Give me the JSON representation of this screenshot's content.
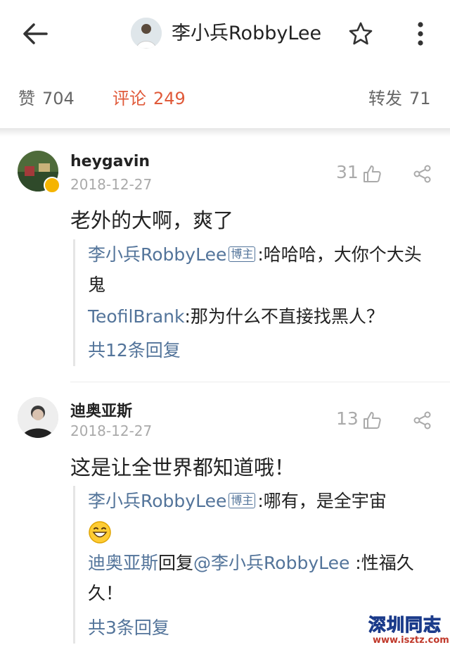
{
  "header": {
    "title": "李小兵RobbyLee"
  },
  "stats": {
    "likes_label": "赞",
    "likes_count": "704",
    "comments_label": "评论",
    "comments_count": "249",
    "reposts_label": "转发",
    "reposts_count": "71"
  },
  "comments": [
    {
      "username": "heygavin",
      "date": "2018-12-27",
      "likes": "31",
      "text": "老外的大啊，爽了",
      "replies": [
        {
          "user": "李小兵RobbyLee",
          "badge": "博主",
          "text": ":哈哈哈，大你个大头鬼"
        },
        {
          "user": "TeofilBrank",
          "text": ":那为什么不直接找黑人？"
        }
      ],
      "more_replies": "共12条回复"
    },
    {
      "username": "迪奥亚斯",
      "date": "2018-12-27",
      "likes": "13",
      "text": "这是让全世界都知道哦！",
      "replies": [
        {
          "user": "李小兵RobbyLee",
          "badge": "博主",
          "text": ":哪有，是全宇宙"
        },
        {
          "user": "迪奥亚斯",
          "mid": "回复",
          "mention": "@李小兵RobbyLee",
          "text": " :性福久久！"
        }
      ],
      "more_replies": "共3条回复"
    }
  ],
  "watermark": {
    "title": "深圳同志",
    "url": "www.isztz.com"
  },
  "colors": {
    "accent": "#e05a3a",
    "link": "#53749a",
    "muted": "#aaaaaa"
  }
}
